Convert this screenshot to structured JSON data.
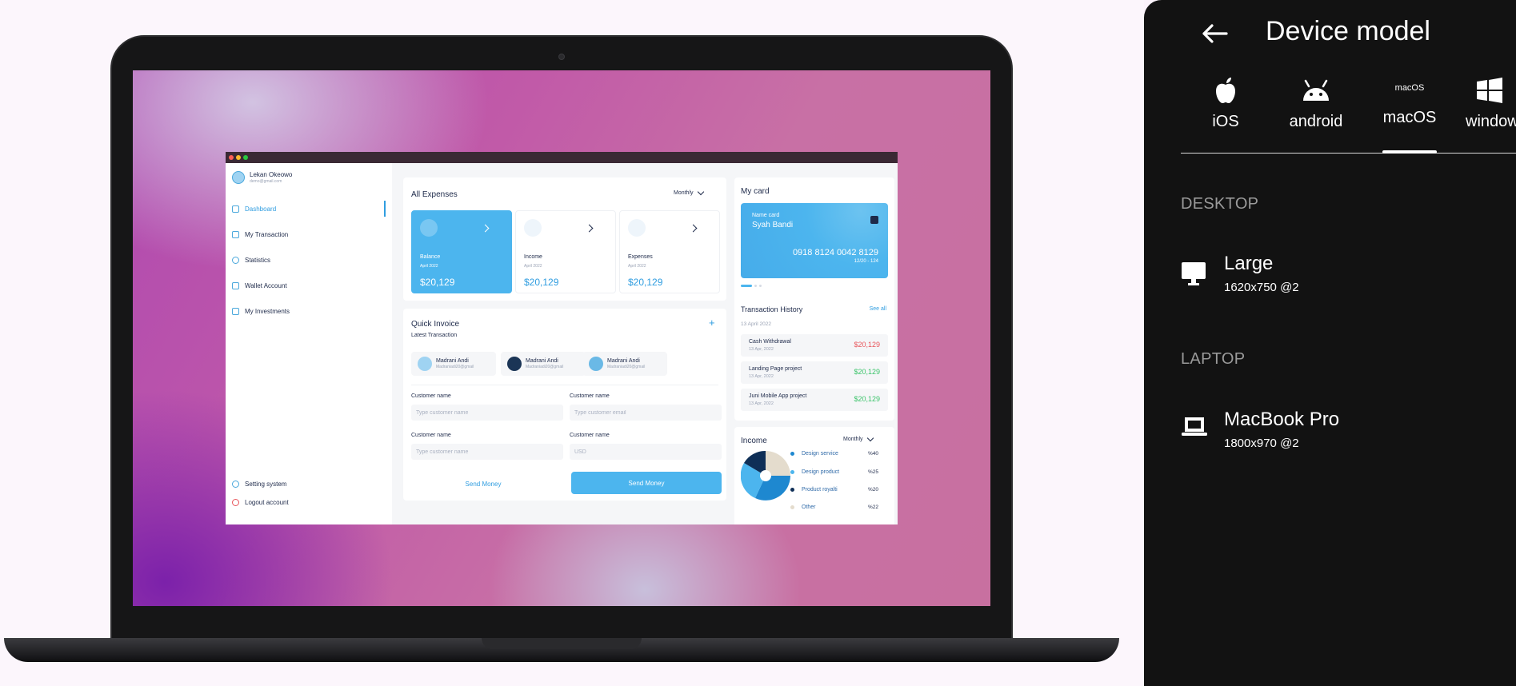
{
  "app": {
    "user": {
      "name": "Lekan Okeowo",
      "email": "demo@gmail.com"
    },
    "nav": [
      "Dashboard",
      "My Transaction",
      "Statistics",
      "Wallet Account",
      "My Investments"
    ],
    "nav_bottom": [
      "Setting system",
      "Logout account"
    ],
    "expenses": {
      "title": "All Expenses",
      "period": "Monthly",
      "cards": [
        {
          "label": "Balance",
          "date": "April 2022",
          "value": "$20,129"
        },
        {
          "label": "Income",
          "date": "April 2022",
          "value": "$20,129"
        },
        {
          "label": "Expenses",
          "date": "April 2022",
          "value": "$20,129"
        }
      ]
    },
    "invoice": {
      "title": "Quick Invoice",
      "subtitle": "Latest Transaction",
      "contacts": [
        {
          "name": "Madrani Andi",
          "email": "Madraniadi20@gmail"
        },
        {
          "name": "Madrani Andi",
          "email": "Madraniadi20@gmail"
        },
        {
          "name": "Madrani Andi",
          "email": "Madraniadi20@gmail"
        }
      ],
      "fields": [
        {
          "label": "Customer name",
          "placeholder": "Type customer name"
        },
        {
          "label": "Customer name",
          "placeholder": "Type customer email"
        },
        {
          "label": "Customer name",
          "placeholder": "Type customer name"
        },
        {
          "label": "Customer name",
          "placeholder": "USD"
        }
      ],
      "btn_ghost": "Send Money",
      "btn_solid": "Send Money"
    },
    "mycard": {
      "title": "My card",
      "label": "Name card",
      "holder": "Syah Bandi",
      "number": "0918 8124 0042 8129",
      "expiry": "12/20 - 124"
    },
    "history": {
      "title": "Transaction History",
      "see_all": "See all",
      "date": "13 April 2022",
      "items": [
        {
          "name": "Cash Withdrawal",
          "date": "13 Apr, 2022",
          "amount": "$20,129",
          "color": "#e8545a"
        },
        {
          "name": "Landing Page project",
          "date": "13 Apr, 2022",
          "amount": "$20,129",
          "color": "#3bc46a"
        },
        {
          "name": "Juni Mobile App project",
          "date": "13 Apr, 2022",
          "amount": "$20,129",
          "color": "#3bc46a"
        }
      ]
    },
    "income": {
      "title": "Income",
      "period": "Monthly",
      "legend": [
        {
          "name": "Design service",
          "value": "%40",
          "color": "#1e88d0"
        },
        {
          "name": "Design product",
          "value": "%25",
          "color": "#4cb5ee"
        },
        {
          "name": "Product royalti",
          "value": "%20",
          "color": "#0f2f57"
        },
        {
          "name": "Other",
          "value": "%22",
          "color": "#e4dccd"
        }
      ]
    }
  },
  "panel": {
    "title": "Device model",
    "tabs": [
      {
        "label": "iOS"
      },
      {
        "label": "android"
      },
      {
        "label": "macOS",
        "badge": "macOS"
      },
      {
        "label": "windows"
      }
    ],
    "sections": [
      {
        "heading": "DESKTOP",
        "device": "Large",
        "resolution": "1620x750 @2"
      },
      {
        "heading": "LAPTOP",
        "device": "MacBook Pro",
        "resolution": "1800x970 @2"
      }
    ]
  },
  "colors": {
    "accent": "#4cb5ee",
    "panel_bg": "#121212",
    "chrome": "#3a2934"
  }
}
